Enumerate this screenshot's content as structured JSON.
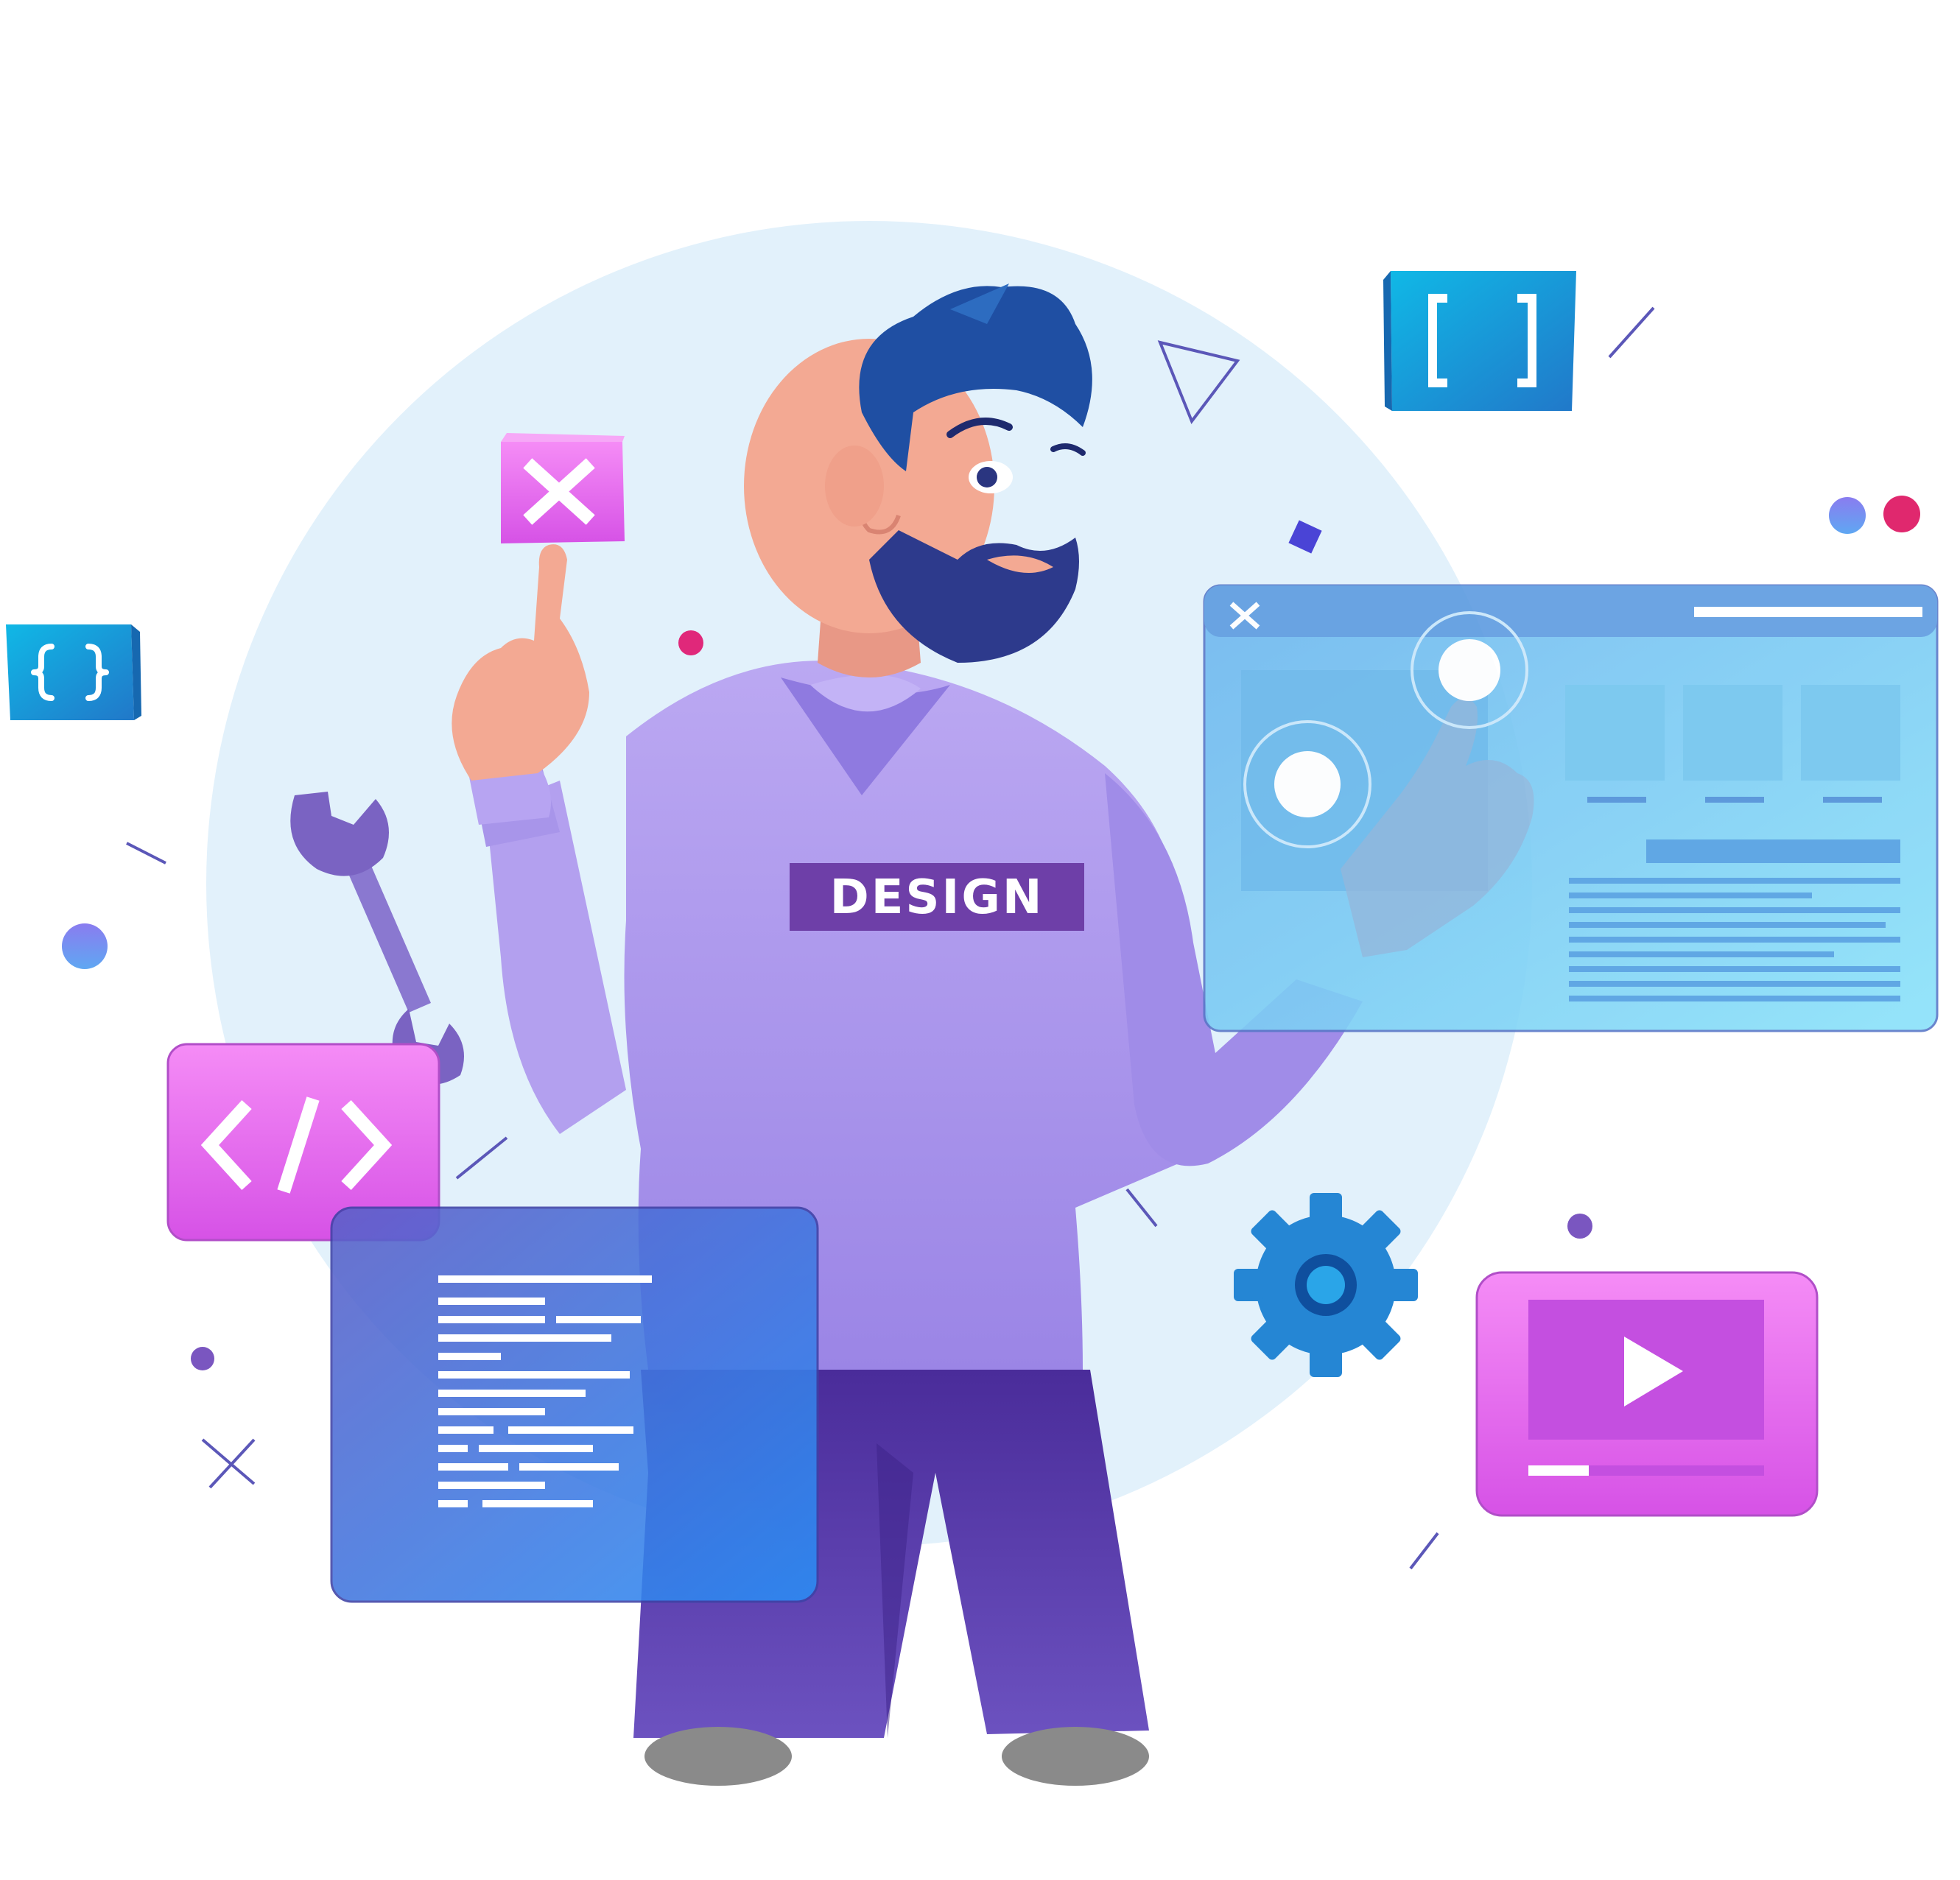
{
  "illustration": {
    "shirt_text": "DESIGN",
    "icons": {
      "close": "close-icon",
      "code": "code-icon",
      "brackets": "square-brackets-icon",
      "braces": "curly-braces-icon",
      "wrench": "wrench-icon",
      "gear": "gear-icon",
      "play": "play-icon"
    }
  },
  "colors": {
    "background": "#ffffff",
    "circle": "#e2f1fb",
    "hair": "#1f4fa3",
    "beard": "#2d3a8c",
    "skin": "#f3a993",
    "shirt": "#a996ea",
    "pants": "#5d44b2",
    "pink_panel": "#ec7ff0",
    "blue_panel": "#3f7fe0",
    "screen": "#7fd3f5",
    "cyan_box": "#1aa3d8",
    "gear": "#2a8fd9"
  }
}
